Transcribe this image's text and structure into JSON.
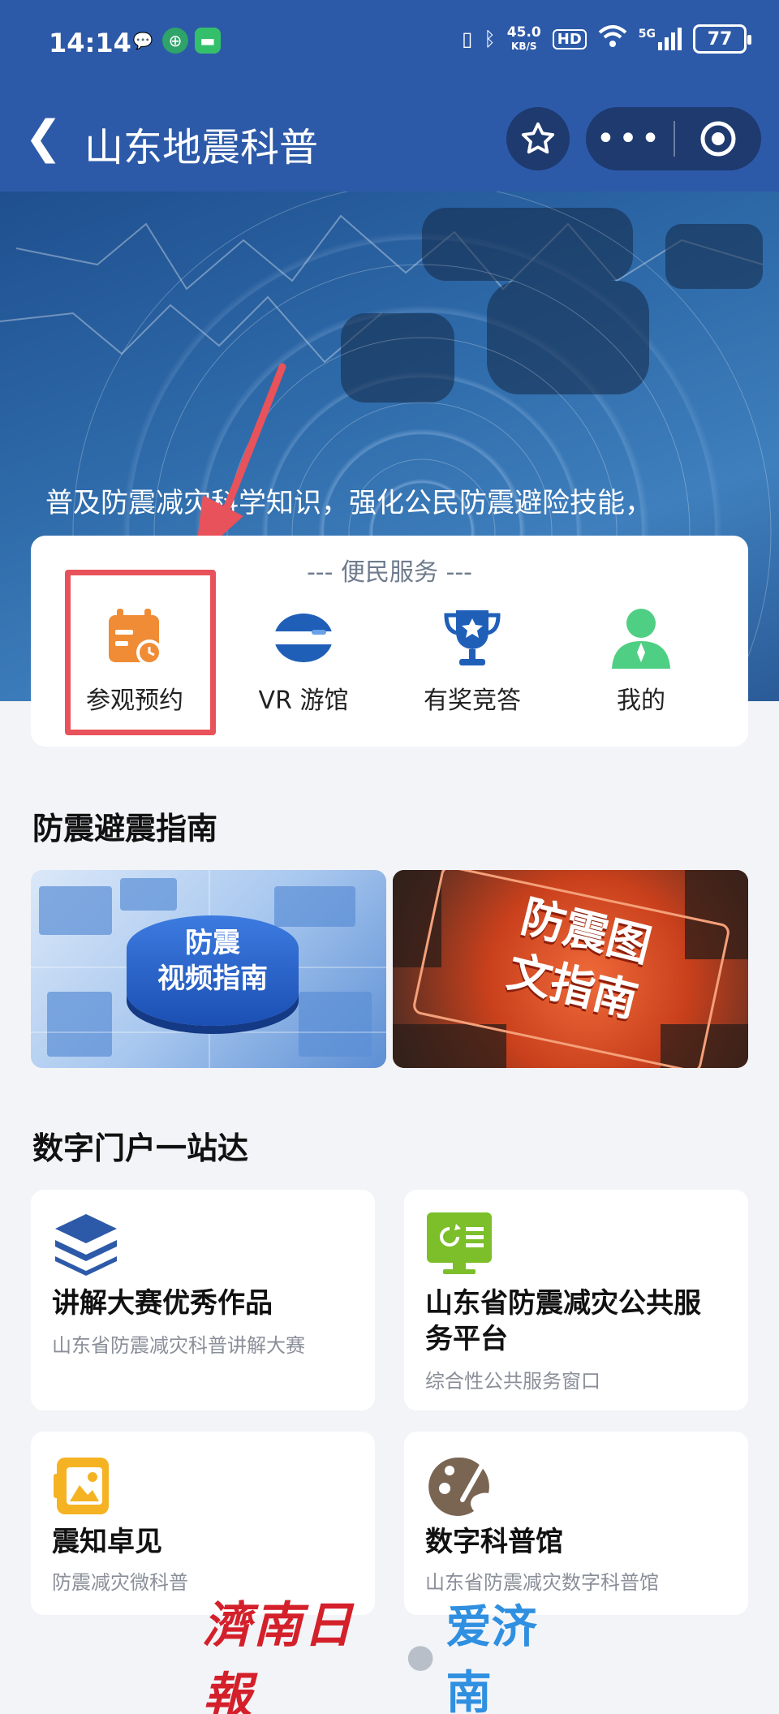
{
  "status_bar": {
    "time": "14:14",
    "net_speed_value": "45.0",
    "net_speed_unit": "KB/S",
    "hd": "HD",
    "net_gen": "5G",
    "battery": "77"
  },
  "titlebar": {
    "title": "山东地震科普"
  },
  "hero": {
    "tagline": "普及防震减灾科学知识，强化公民防震避险技能，"
  },
  "service": {
    "heading": "---   便民服务   ---",
    "items": [
      {
        "label": "参观预约",
        "icon": "calendar-clock-icon"
      },
      {
        "label": "VR 游馆",
        "icon": "vr-headset-icon"
      },
      {
        "label": "有奖竞答",
        "icon": "trophy-icon"
      },
      {
        "label": "我的",
        "icon": "user-icon"
      }
    ]
  },
  "guide_section": {
    "title": "防震避震指南",
    "banners": [
      {
        "text_line1": "防震",
        "text_line2": "视频指南"
      },
      {
        "text_line1": "防震图",
        "text_line2": "文指南"
      }
    ]
  },
  "portal_section": {
    "title": "数字门户一站达",
    "cards": [
      {
        "title": "讲解大赛优秀作品",
        "subtitle": "山东省防震减灾科普讲解大赛",
        "icon": "layers-icon"
      },
      {
        "title_line1": "山东省防震减灾公共服",
        "title_line2": "务平台",
        "subtitle": "综合性公共服务窗口",
        "icon": "monitor-icon"
      },
      {
        "title": "震知卓见",
        "subtitle": "防震减灾微科普",
        "icon": "picture-note-icon"
      },
      {
        "title": "数字科普馆",
        "subtitle": "山东省防震减灾数字科普馆",
        "icon": "palette-icon"
      }
    ]
  },
  "watermark": {
    "left": "濟南日報",
    "right": "爱济南"
  },
  "colors": {
    "brand_blue": "#2d5aa8",
    "highlight_red": "#e8525a",
    "orange": "#ef8c35",
    "blue_icon": "#1f5fb8",
    "green": "#4fcf83"
  }
}
